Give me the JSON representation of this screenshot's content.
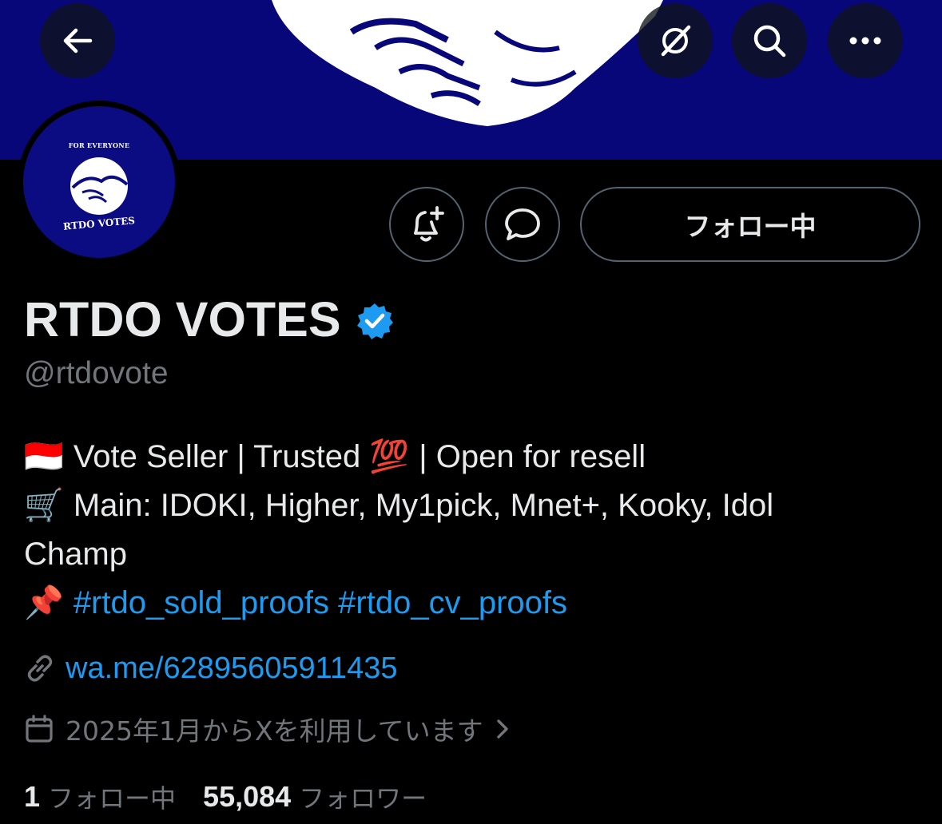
{
  "banner": {
    "color": "#07077a",
    "image": "handshake"
  },
  "nav": {
    "back_icon": "arrow-left-icon",
    "grok_icon": "grok-icon",
    "search_icon": "search-icon",
    "more_icon": "more-icon"
  },
  "avatar": {
    "top_text": "FOR EVERYONE",
    "bottom_text": "RTDO VOTES"
  },
  "actions": {
    "notify_icon": "bell-plus-icon",
    "message_icon": "message-icon",
    "follow_label": "フォロー中"
  },
  "profile": {
    "display_name": "RTDO VOTES",
    "verified": true,
    "handle": "@rtdovote"
  },
  "bio": {
    "line1_flag": "🇮🇩",
    "line1_a": "Vote Seller | Trusted",
    "line1_emoji": "💯",
    "line1_b": "| Open for resell",
    "line2_emoji": "🛒",
    "line2_text": "Main: IDOKI, Higher, My1pick, Mnet+, Kooky, Idol",
    "line3_text": "Champ",
    "line4_emoji": "📌",
    "hashtag1": "#rtdo_sold_proofs",
    "hashtag2": "#rtdo_cv_proofs"
  },
  "url": {
    "icon": "link-icon",
    "text": "wa.me/62895605911435"
  },
  "joined": {
    "icon": "calendar-icon",
    "text": "2025年1月からXを利用しています",
    "chevron": "chevron-right-icon"
  },
  "stats": {
    "following_count": "1",
    "following_label": "フォロー中",
    "followers_count": "55,084",
    "followers_label": "フォロワー"
  },
  "colors": {
    "accent": "#1d9bf0",
    "muted": "#71767b",
    "text": "#e7e9ea",
    "border": "#536471"
  }
}
